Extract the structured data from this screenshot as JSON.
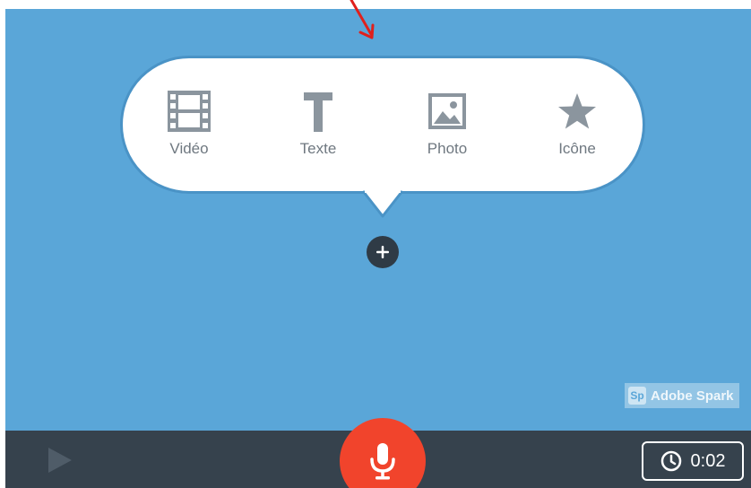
{
  "canvas": {
    "background_color": "#5aa6d8"
  },
  "insert_menu": {
    "items": [
      {
        "label": "Vidéo",
        "icon": "film-icon"
      },
      {
        "label": "Texte",
        "icon": "text-t-icon"
      },
      {
        "label": "Photo",
        "icon": "image-icon"
      },
      {
        "label": "Icône",
        "icon": "star-icon"
      }
    ],
    "icon_color": "#8b959e"
  },
  "add_button": {
    "icon": "plus-icon"
  },
  "watermark": {
    "badge": "Sp",
    "text": "Adobe Spark"
  },
  "player_bar": {
    "background_color": "#36424d",
    "play_icon": "play-icon",
    "mic_icon": "microphone-icon",
    "mic_color": "#f1442c",
    "timer_icon": "clock-icon",
    "duration": "0:02"
  },
  "annotation": {
    "arrow_color": "#e0201c"
  }
}
